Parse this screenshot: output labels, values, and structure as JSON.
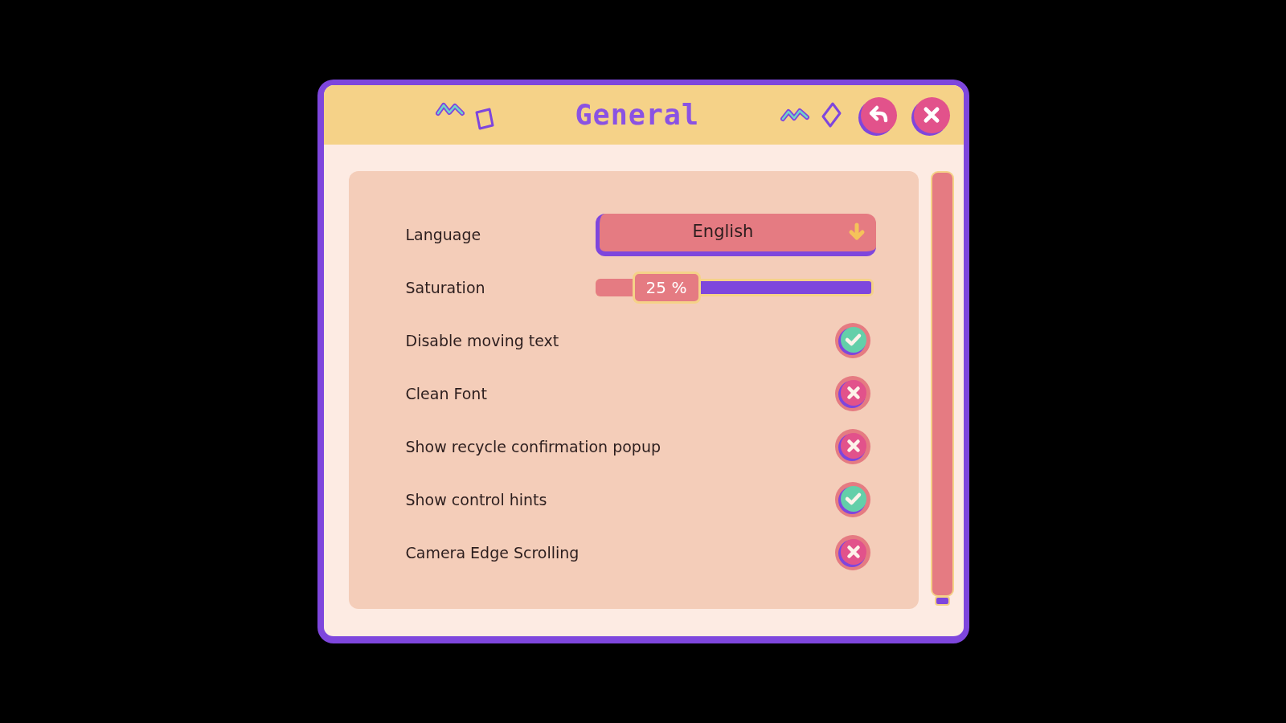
{
  "window": {
    "title": "General"
  },
  "settings": [
    {
      "kind": "dropdown",
      "label": "Language",
      "value": "English"
    },
    {
      "kind": "slider",
      "label": "Saturation",
      "level": 0.25,
      "reading": "25 %"
    },
    {
      "kind": "toggle",
      "label": "Disable moving text",
      "checked": true
    },
    {
      "kind": "toggle",
      "label": "Clean Font",
      "checked": false
    },
    {
      "kind": "toggle",
      "label": "Show recycle confirmation popup",
      "checked": false
    },
    {
      "kind": "toggle",
      "label": "Show control hints",
      "checked": true
    },
    {
      "kind": "toggle",
      "label": "Camera Edge Scrolling",
      "checked": false
    }
  ]
}
